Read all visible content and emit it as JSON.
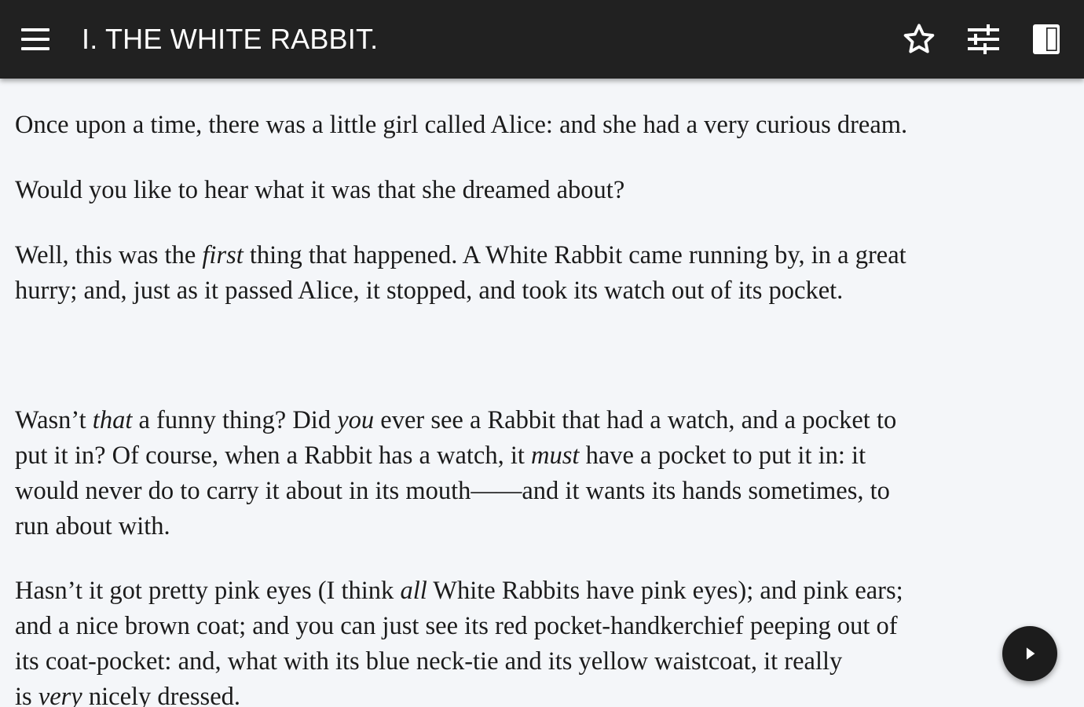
{
  "toolbar": {
    "title": "I. THE WHITE RABBIT.",
    "background": "#212121",
    "icons": [
      "menu-icon",
      "star-outline-icon",
      "tune-sliders-icon",
      "book-icon"
    ]
  },
  "content": {
    "p1": {
      "l1": "Once upon a time, there was a little girl called Alice: and she had a very curious dream."
    },
    "p2": {
      "l1": "Would you like to hear what it was that she dreamed about?"
    },
    "p3": {
      "l1a": "Well, this was the ",
      "l1em": "first",
      "l1b": " thing that happened. A White Rabbit came running by, in a great",
      "l2": "hurry; and, just as it passed Alice, it stopped, and took its watch out of its pocket."
    },
    "p4": {
      "l1a": "Wasn’t ",
      "l1em1": "that",
      "l1b": " a funny thing? Did ",
      "l1em2": "you",
      "l1c": " ever see a Rabbit that had a watch, and a pocket to",
      "l2a": "put it in? Of course, when a Rabbit has a watch, it ",
      "l2em": "must",
      "l2b": " have a pocket to put it in: it",
      "l3": "would never do to carry it about in its mouth——and it wants its hands sometimes, to",
      "l4": "run about with."
    },
    "p5": {
      "l1a": "Hasn’t it got pretty pink eyes (I think ",
      "l1em": "all",
      "l1b": " White Rabbits have pink eyes); and pink ears;",
      "l2": "and a nice brown coat; and you can just see its red pocket-handkerchief peeping out of",
      "l3": "its coat-pocket: and, what with its blue neck-tie and its yellow waistcoat, it really",
      "l4a": "is ",
      "l4em": "very",
      "l4b": " nicely dressed."
    }
  },
  "fab": {
    "icon": "play-arrow-icon"
  }
}
